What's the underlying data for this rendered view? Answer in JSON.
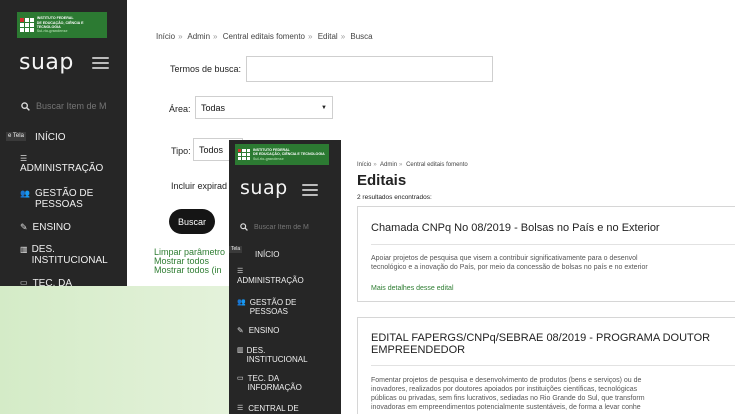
{
  "brand": "suap",
  "logo_text": [
    "INSTITUTO FEDERAL",
    "DE EDUCAÇÃO, CIÊNCIA E TECNOLOGIA",
    "Sul-rio-grandense"
  ],
  "tela_tag": "e Tela",
  "tela_tag2": "Tela",
  "sidebar": {
    "search_placeholder": "Buscar Item de M",
    "items": [
      "INÍCIO",
      "ADMINISTRAÇÃO",
      "GESTÃO DE PESSOAS",
      "ENSINO",
      "DES. INSTITUCIONAL",
      "TEC. DA INFORMAÇÃO",
      "CENTRAL DE"
    ]
  },
  "search_page": {
    "breadcrumb": [
      "Início",
      "Admin",
      "Central editais fomento",
      "Edital",
      "Busca"
    ],
    "termos_label": "Termos de busca:",
    "area_label": "Área:",
    "area_value": "Todas",
    "tipo_label": "Tipo:",
    "tipo_value": "Todos",
    "incluir_label": "Incluir expirad",
    "buscar_button": "Buscar",
    "links": [
      "Limpar parâmetro",
      "Mostrar todos",
      "Mostrar todos (in"
    ]
  },
  "editais_page": {
    "breadcrumb": [
      "Início",
      "Admin",
      "Central editais fomento"
    ],
    "title": "Editais",
    "results": "2 resultados encontrados:",
    "cards": [
      {
        "title": "Chamada CNPq No 08/2019 - Bolsas no País e no Exterior",
        "desc": [
          "Apoiar projetos de pesquisa que visem a contribuir significativamente para o desenvol",
          "tecnológico e a inovação do País, por meio da concessão de bolsas no país e no exterior"
        ],
        "link": "Mais detalhes desse edital"
      },
      {
        "title": [
          "EDITAL FAPERGS/CNPq/SEBRAE 08/2019 - PROGRAMA DOUTOR",
          "EMPREENDEDOR"
        ],
        "desc": [
          "Fomentar projetos de pesquisa e desenvolvimento de produtos (bens e serviços) ou de",
          "inovadores, realizados por doutores apoiados por instituições científicas, tecnológicas",
          "públicas ou privadas, sem fins lucrativos, sediadas no Rio Grande do Sul, que transform",
          "inovadoras em empreendimentos potencialmente sustentáveis, de forma a levar conhe"
        ]
      }
    ]
  }
}
